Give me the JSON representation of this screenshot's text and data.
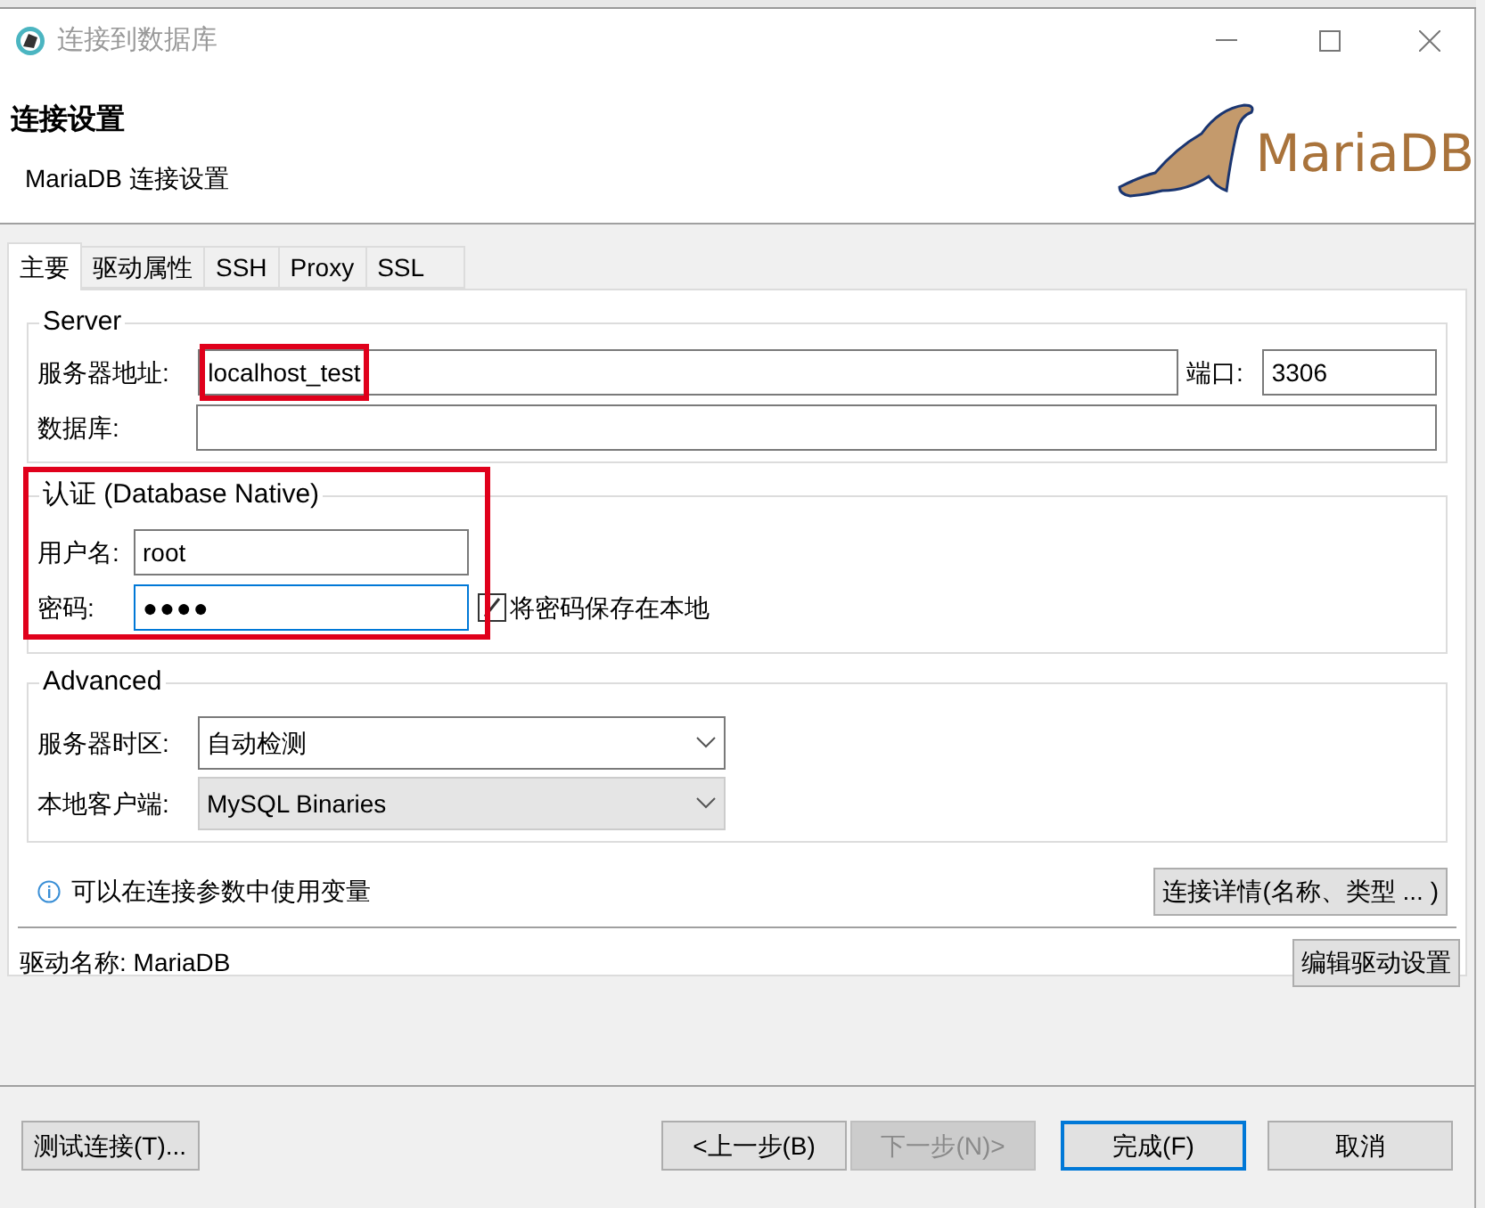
{
  "window": {
    "title": "连接到数据库"
  },
  "header": {
    "title": "连接设置",
    "subtitle": "MariaDB 连接设置",
    "logo_text": "MariaDB"
  },
  "tabs": [
    {
      "label": "主要",
      "selected": true
    },
    {
      "label": "驱动属性",
      "selected": false
    },
    {
      "label": "SSH",
      "selected": false
    },
    {
      "label": "Proxy",
      "selected": false
    },
    {
      "label": "SSL",
      "selected": false
    }
  ],
  "server": {
    "legend": "Server",
    "host": {
      "label": "服务器地址:",
      "value": "localhost_test",
      "highlighted": true
    },
    "port": {
      "label": "端口:",
      "value": "3306"
    },
    "database": {
      "label": "数据库:"
    }
  },
  "auth": {
    "legend": "认证 (Database Native)",
    "highlighted": true,
    "user": {
      "label": "用户名:",
      "value": "root"
    },
    "password": {
      "label": "密码:",
      "value": "●●●●",
      "focused": true
    },
    "save_password": {
      "label": "将密码保存在本地",
      "checked": true
    }
  },
  "advanced": {
    "legend": "Advanced",
    "timezone": {
      "label": "服务器时区:",
      "value": "自动检测",
      "readonly": false
    },
    "client": {
      "label": "本地客户端:",
      "value": "MySQL Binaries",
      "readonly": true
    }
  },
  "info": "可以在连接参数中使用变量",
  "details_button": "连接详情(名称、类型 ... )",
  "driver": {
    "label": "驱动名称:",
    "value": "MariaDB"
  },
  "edit_driver_button": "编辑驱动设置",
  "test_button": "测试连接(T)...",
  "buttons": [
    {
      "label": "<上一步(B)",
      "disabled": false,
      "default": false
    },
    {
      "label": "下一步(N)>",
      "disabled": true,
      "default": false
    },
    {
      "label": "完成(F)",
      "disabled": false,
      "default": true
    },
    {
      "label": "取消",
      "disabled": false,
      "default": false
    }
  ]
}
